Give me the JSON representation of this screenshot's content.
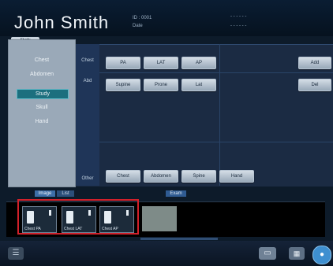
{
  "header": {
    "patient_name": "John Smith",
    "info_left_1": "ID : 0001",
    "info_left_2": "Date",
    "info_right_1": "- - - - - -",
    "info_right_2": "- - - - - -"
  },
  "left_panel": {
    "tab_label": "Study",
    "items": [
      {
        "label": "Chest",
        "active": false
      },
      {
        "label": "Abdomen",
        "active": false
      },
      {
        "label": "Study",
        "active": true
      },
      {
        "label": "Skull",
        "active": false
      },
      {
        "label": "Hand",
        "active": false
      }
    ]
  },
  "main": {
    "row_labels": [
      "Chest",
      "Abd",
      "Other"
    ],
    "row1_buttons": [
      "PA",
      "LAT",
      "AP"
    ],
    "row2_buttons": [
      "Supine",
      "Prone",
      "Lat"
    ],
    "bottom_buttons": [
      "Chest",
      "Abdomen",
      "Spine",
      "Hand"
    ],
    "right_buttons": [
      "Add",
      "Del"
    ]
  },
  "strip": {
    "tab1": "Image",
    "tab2": "List",
    "tab3": "Exam",
    "thumbnails": [
      {
        "label": "Chest PA"
      },
      {
        "label": "Chest LAT"
      },
      {
        "label": "Chest AP"
      }
    ]
  },
  "footer": {
    "buttons": [
      "menu",
      "monitor",
      "output",
      "end"
    ]
  },
  "colors": {
    "accent": "#1c6f7e",
    "highlight": "#d2202a",
    "background": "#0d1b2a"
  }
}
